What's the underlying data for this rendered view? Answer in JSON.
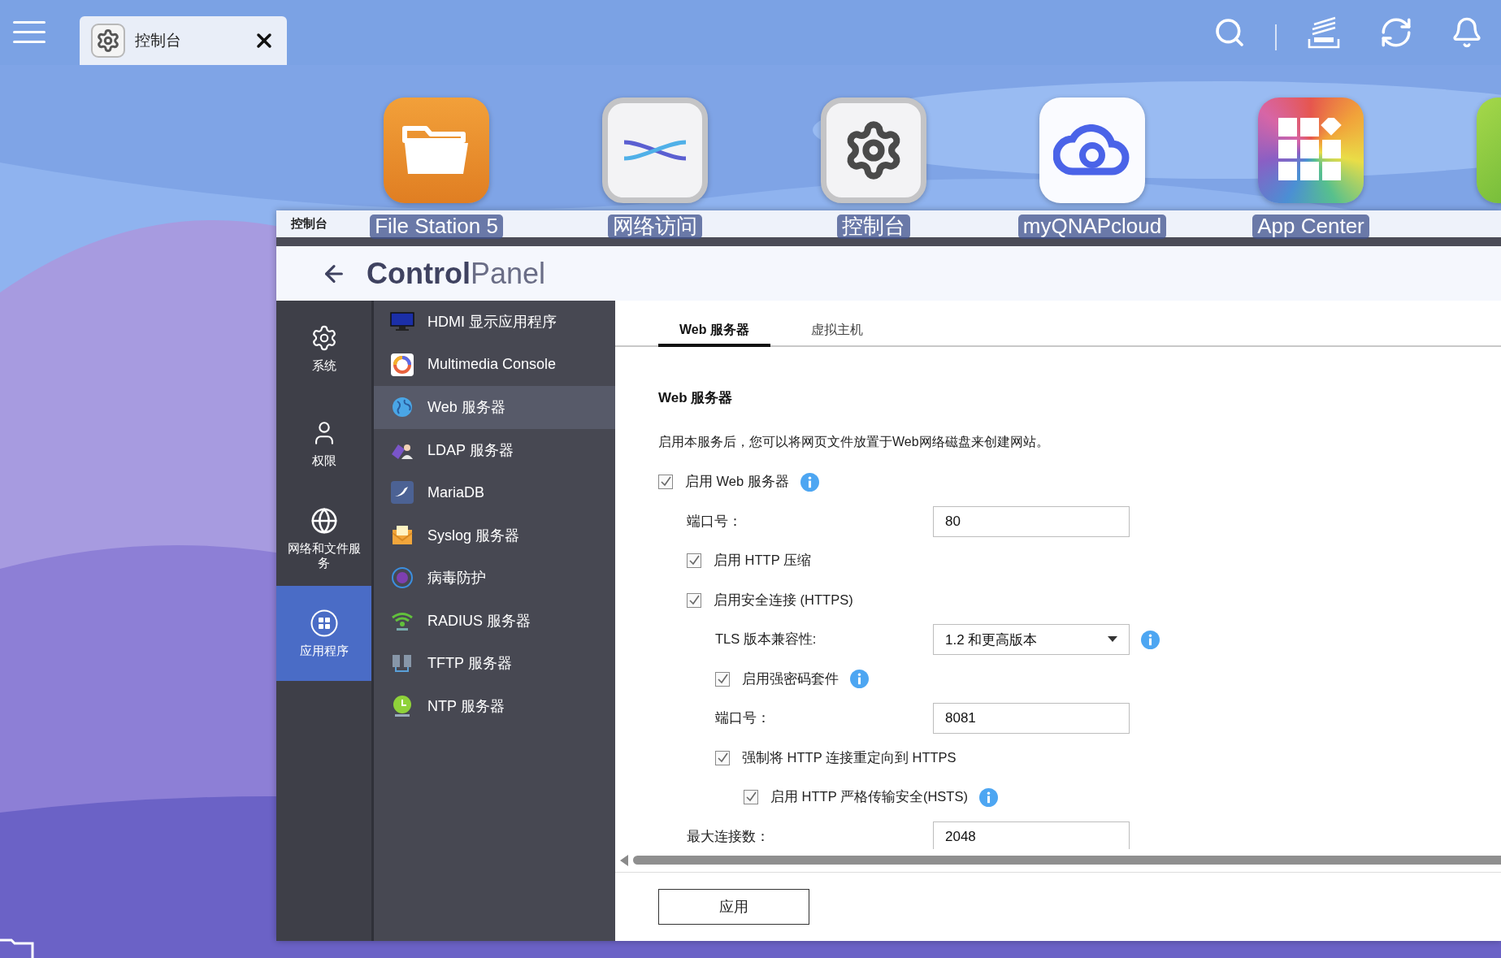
{
  "topbar": {
    "tab": {
      "label": "控制台"
    }
  },
  "desktop_icons": [
    {
      "label": "File Station 5",
      "kind": "folder"
    },
    {
      "label": "网络访问",
      "kind": "arrows"
    },
    {
      "label": "控制台",
      "kind": "gear"
    },
    {
      "label": "myQNAPcloud",
      "kind": "cloud"
    },
    {
      "label": "App Center",
      "kind": "grid"
    },
    {
      "kind": "green"
    }
  ],
  "window": {
    "title": "控制台",
    "header": {
      "bold": "Control",
      "light": "Panel"
    }
  },
  "nav": [
    {
      "label": "系统",
      "kind": "gear",
      "selected": false
    },
    {
      "label": "权限",
      "kind": "user",
      "selected": false
    },
    {
      "label": "网络和文件服务",
      "kind": "globe",
      "selected": false
    },
    {
      "label": "应用程序",
      "kind": "apps",
      "selected": true
    }
  ],
  "apps": [
    {
      "label": "HDMI 显示应用程序",
      "kind": "hdmi",
      "selected": false
    },
    {
      "label": "Multimedia Console",
      "kind": "multimedia",
      "selected": false
    },
    {
      "label": "Web 服务器",
      "kind": "web",
      "selected": true
    },
    {
      "label": "LDAP 服务器",
      "kind": "ldap",
      "selected": false
    },
    {
      "label": "MariaDB",
      "kind": "mariadb",
      "selected": false
    },
    {
      "label": "Syslog 服务器",
      "kind": "syslog",
      "selected": false
    },
    {
      "label": "病毒防护",
      "kind": "virus",
      "selected": false
    },
    {
      "label": "RADIUS 服务器",
      "kind": "radius",
      "selected": false
    },
    {
      "label": "TFTP 服务器",
      "kind": "tftp",
      "selected": false
    },
    {
      "label": "NTP 服务器",
      "kind": "ntp",
      "selected": false
    }
  ],
  "tabs": [
    {
      "label": "Web 服务器",
      "selected": true
    },
    {
      "label": "虚拟主机",
      "selected": false
    }
  ],
  "section_title": "Web 服务器",
  "description": "启用本服务后，您可以将网页文件放置于Web网络磁盘来创建网站。",
  "settings": [
    {
      "kind": "checkbox",
      "label": "启用 Web 服务器",
      "checked": true,
      "info": true,
      "children": [
        {
          "kind": "field",
          "label": "端口号：",
          "value": "80"
        },
        {
          "kind": "checkbox",
          "label": "启用 HTTP 压缩",
          "checked": true
        },
        {
          "kind": "checkbox",
          "label": "启用安全连接 (HTTPS)",
          "checked": true,
          "children": [
            {
              "kind": "select",
              "label": "TLS 版本兼容性:",
              "value": "1.2 和更高版本",
              "info": true
            },
            {
              "kind": "checkbox",
              "label": "启用强密码套件",
              "checked": true,
              "info": true
            },
            {
              "kind": "field",
              "label": "端口号：",
              "value": "8081"
            },
            {
              "kind": "checkbox",
              "label": "强制将 HTTP 连接重定向到 HTTPS",
              "checked": true,
              "children": [
                {
                  "kind": "checkbox",
                  "label": "启用 HTTP 严格传输安全(HSTS)",
                  "checked": true,
                  "info": true
                }
              ]
            }
          ]
        },
        {
          "kind": "field",
          "label": "最大连接数：",
          "value": "2048"
        }
      ]
    }
  ],
  "apply_button": "应用"
}
